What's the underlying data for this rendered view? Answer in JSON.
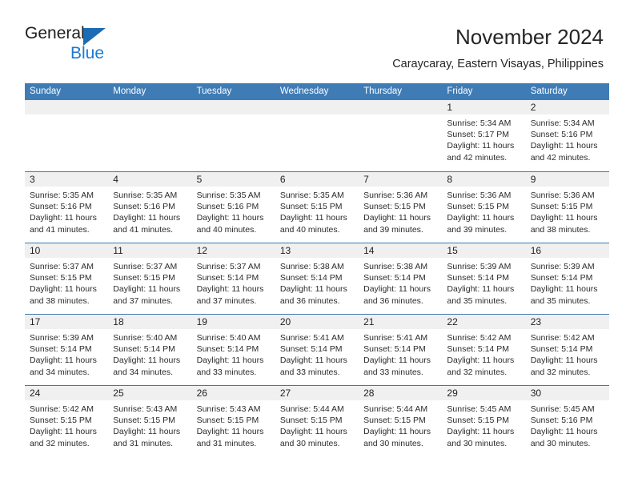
{
  "brand": {
    "name_top": "General",
    "name_bottom": "Blue",
    "accent_color": "#1b7ad1",
    "triangle_color": "#1b6cb5"
  },
  "header": {
    "title": "November 2024",
    "subtitle": "Caraycaray, Eastern Visayas, Philippines"
  },
  "calendar": {
    "header_bg": "#3f7cb6",
    "day_band_bg": "#f0f0f0",
    "weekdays": [
      "Sunday",
      "Monday",
      "Tuesday",
      "Wednesday",
      "Thursday",
      "Friday",
      "Saturday"
    ],
    "weeks": [
      [
        {
          "day": "",
          "sunrise": "",
          "sunset": "",
          "daylight": "",
          "empty": true
        },
        {
          "day": "",
          "sunrise": "",
          "sunset": "",
          "daylight": "",
          "empty": true
        },
        {
          "day": "",
          "sunrise": "",
          "sunset": "",
          "daylight": "",
          "empty": true
        },
        {
          "day": "",
          "sunrise": "",
          "sunset": "",
          "daylight": "",
          "empty": true
        },
        {
          "day": "",
          "sunrise": "",
          "sunset": "",
          "daylight": "",
          "empty": true
        },
        {
          "day": "1",
          "sunrise": "Sunrise: 5:34 AM",
          "sunset": "Sunset: 5:17 PM",
          "daylight": "Daylight: 11 hours and 42 minutes."
        },
        {
          "day": "2",
          "sunrise": "Sunrise: 5:34 AM",
          "sunset": "Sunset: 5:16 PM",
          "daylight": "Daylight: 11 hours and 42 minutes."
        }
      ],
      [
        {
          "day": "3",
          "sunrise": "Sunrise: 5:35 AM",
          "sunset": "Sunset: 5:16 PM",
          "daylight": "Daylight: 11 hours and 41 minutes."
        },
        {
          "day": "4",
          "sunrise": "Sunrise: 5:35 AM",
          "sunset": "Sunset: 5:16 PM",
          "daylight": "Daylight: 11 hours and 41 minutes."
        },
        {
          "day": "5",
          "sunrise": "Sunrise: 5:35 AM",
          "sunset": "Sunset: 5:16 PM",
          "daylight": "Daylight: 11 hours and 40 minutes."
        },
        {
          "day": "6",
          "sunrise": "Sunrise: 5:35 AM",
          "sunset": "Sunset: 5:15 PM",
          "daylight": "Daylight: 11 hours and 40 minutes."
        },
        {
          "day": "7",
          "sunrise": "Sunrise: 5:36 AM",
          "sunset": "Sunset: 5:15 PM",
          "daylight": "Daylight: 11 hours and 39 minutes."
        },
        {
          "day": "8",
          "sunrise": "Sunrise: 5:36 AM",
          "sunset": "Sunset: 5:15 PM",
          "daylight": "Daylight: 11 hours and 39 minutes."
        },
        {
          "day": "9",
          "sunrise": "Sunrise: 5:36 AM",
          "sunset": "Sunset: 5:15 PM",
          "daylight": "Daylight: 11 hours and 38 minutes."
        }
      ],
      [
        {
          "day": "10",
          "sunrise": "Sunrise: 5:37 AM",
          "sunset": "Sunset: 5:15 PM",
          "daylight": "Daylight: 11 hours and 38 minutes."
        },
        {
          "day": "11",
          "sunrise": "Sunrise: 5:37 AM",
          "sunset": "Sunset: 5:15 PM",
          "daylight": "Daylight: 11 hours and 37 minutes."
        },
        {
          "day": "12",
          "sunrise": "Sunrise: 5:37 AM",
          "sunset": "Sunset: 5:14 PM",
          "daylight": "Daylight: 11 hours and 37 minutes."
        },
        {
          "day": "13",
          "sunrise": "Sunrise: 5:38 AM",
          "sunset": "Sunset: 5:14 PM",
          "daylight": "Daylight: 11 hours and 36 minutes."
        },
        {
          "day": "14",
          "sunrise": "Sunrise: 5:38 AM",
          "sunset": "Sunset: 5:14 PM",
          "daylight": "Daylight: 11 hours and 36 minutes."
        },
        {
          "day": "15",
          "sunrise": "Sunrise: 5:39 AM",
          "sunset": "Sunset: 5:14 PM",
          "daylight": "Daylight: 11 hours and 35 minutes."
        },
        {
          "day": "16",
          "sunrise": "Sunrise: 5:39 AM",
          "sunset": "Sunset: 5:14 PM",
          "daylight": "Daylight: 11 hours and 35 minutes."
        }
      ],
      [
        {
          "day": "17",
          "sunrise": "Sunrise: 5:39 AM",
          "sunset": "Sunset: 5:14 PM",
          "daylight": "Daylight: 11 hours and 34 minutes."
        },
        {
          "day": "18",
          "sunrise": "Sunrise: 5:40 AM",
          "sunset": "Sunset: 5:14 PM",
          "daylight": "Daylight: 11 hours and 34 minutes."
        },
        {
          "day": "19",
          "sunrise": "Sunrise: 5:40 AM",
          "sunset": "Sunset: 5:14 PM",
          "daylight": "Daylight: 11 hours and 33 minutes."
        },
        {
          "day": "20",
          "sunrise": "Sunrise: 5:41 AM",
          "sunset": "Sunset: 5:14 PM",
          "daylight": "Daylight: 11 hours and 33 minutes."
        },
        {
          "day": "21",
          "sunrise": "Sunrise: 5:41 AM",
          "sunset": "Sunset: 5:14 PM",
          "daylight": "Daylight: 11 hours and 33 minutes."
        },
        {
          "day": "22",
          "sunrise": "Sunrise: 5:42 AM",
          "sunset": "Sunset: 5:14 PM",
          "daylight": "Daylight: 11 hours and 32 minutes."
        },
        {
          "day": "23",
          "sunrise": "Sunrise: 5:42 AM",
          "sunset": "Sunset: 5:14 PM",
          "daylight": "Daylight: 11 hours and 32 minutes."
        }
      ],
      [
        {
          "day": "24",
          "sunrise": "Sunrise: 5:42 AM",
          "sunset": "Sunset: 5:15 PM",
          "daylight": "Daylight: 11 hours and 32 minutes."
        },
        {
          "day": "25",
          "sunrise": "Sunrise: 5:43 AM",
          "sunset": "Sunset: 5:15 PM",
          "daylight": "Daylight: 11 hours and 31 minutes."
        },
        {
          "day": "26",
          "sunrise": "Sunrise: 5:43 AM",
          "sunset": "Sunset: 5:15 PM",
          "daylight": "Daylight: 11 hours and 31 minutes."
        },
        {
          "day": "27",
          "sunrise": "Sunrise: 5:44 AM",
          "sunset": "Sunset: 5:15 PM",
          "daylight": "Daylight: 11 hours and 30 minutes."
        },
        {
          "day": "28",
          "sunrise": "Sunrise: 5:44 AM",
          "sunset": "Sunset: 5:15 PM",
          "daylight": "Daylight: 11 hours and 30 minutes."
        },
        {
          "day": "29",
          "sunrise": "Sunrise: 5:45 AM",
          "sunset": "Sunset: 5:15 PM",
          "daylight": "Daylight: 11 hours and 30 minutes."
        },
        {
          "day": "30",
          "sunrise": "Sunrise: 5:45 AM",
          "sunset": "Sunset: 5:16 PM",
          "daylight": "Daylight: 11 hours and 30 minutes."
        }
      ]
    ]
  }
}
